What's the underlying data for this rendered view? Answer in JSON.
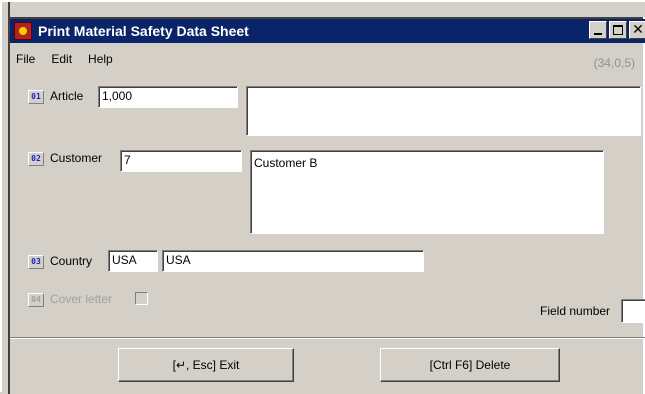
{
  "window": {
    "title": "Print Material Safety Data Sheet",
    "close_glyph": "✕"
  },
  "menu": {
    "items": [
      {
        "label": "File"
      },
      {
        "label": "Edit"
      },
      {
        "label": "Help"
      }
    ]
  },
  "status": {
    "counter": "(34,0,5)"
  },
  "fields": {
    "article": {
      "number": "01",
      "label": "Article",
      "value": "1,000",
      "description": ""
    },
    "customer": {
      "number": "02",
      "label": "Customer",
      "value": "7",
      "description": "Customer B"
    },
    "country": {
      "number": "03",
      "label": "Country",
      "code": "USA",
      "name": "USA"
    },
    "cover_letter": {
      "number": "04",
      "label": "Cover letter",
      "checked": false
    },
    "field_number": {
      "label": "Field number",
      "value": ""
    }
  },
  "buttons": {
    "exit": "[↵, Esc] Exit",
    "delete": "[Ctrl F6] Delete"
  },
  "colors": {
    "title_bar": "#0a246a",
    "window_bg": "#d4d0c8",
    "field_number_text": "#1d1dd0",
    "disabled_text": "#a0a0a0"
  }
}
